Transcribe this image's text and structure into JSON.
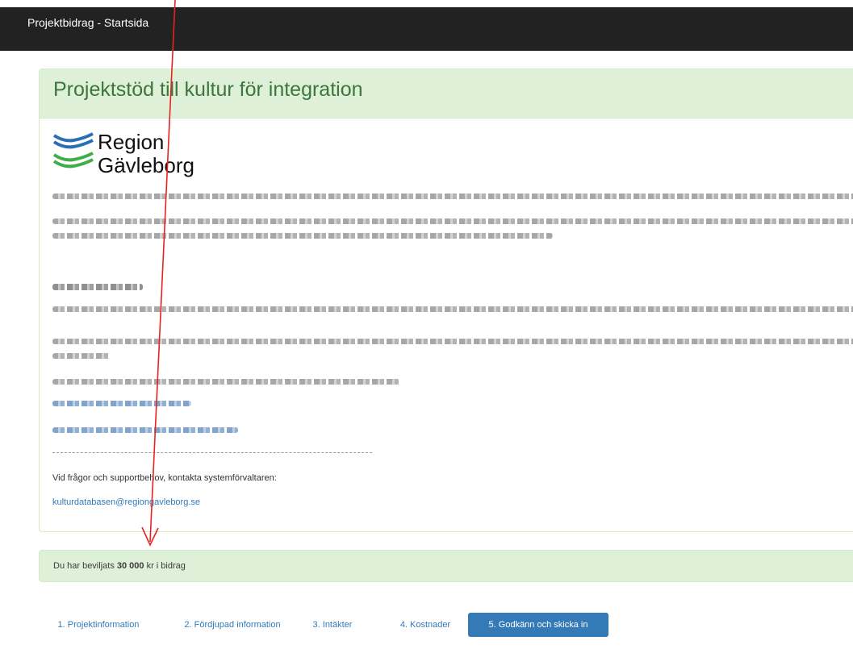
{
  "window": {
    "title": "Projektbidrag - Startsida"
  },
  "panel": {
    "heading": "Projektstöd till kultur för integration",
    "logo_line1": "Region",
    "logo_line2": "Gävleborg",
    "contact_text": "Vid frågor och supportbehov, kontakta systemförvaltaren:",
    "contact_email": "kulturdatabasen@regiongavleborg.se"
  },
  "alert": {
    "prefix": "Du har beviljats ",
    "amount": "30 000",
    "suffix": " kr i bidrag"
  },
  "tabs": [
    {
      "label": "1. Projektinformation"
    },
    {
      "label": "2. Fördjupad information"
    },
    {
      "label": "3. Intäkter"
    },
    {
      "label": "4. Kostnader"
    },
    {
      "label": "5. Godkänn och skicka in"
    }
  ],
  "active_tab": "5. Godkänn och skicka in",
  "colors": {
    "panel_heading_bg": "#dff0d8",
    "panel_heading_text": "#3c763d",
    "link": "#337ab7",
    "topbar": "#222222",
    "annotation_arrow": "#e8231e",
    "logo_blue": "#2a6fb5",
    "logo_green": "#3fae49"
  }
}
